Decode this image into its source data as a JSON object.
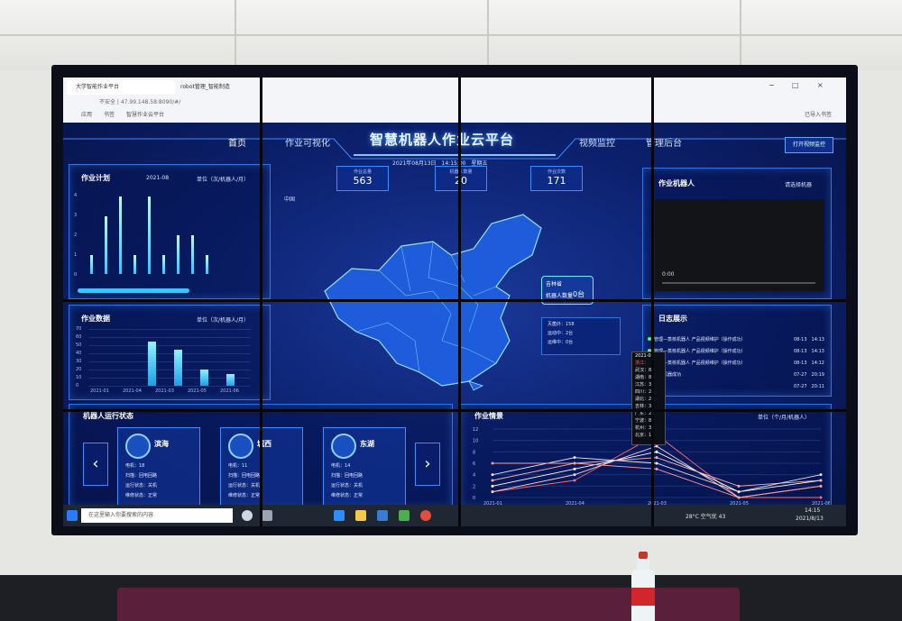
{
  "browser": {
    "tab1": "大学智能作业平台",
    "tab2": "robot管理_智能制造",
    "address": "不安全 | 47.99.148.58:8090/#/",
    "bookmarks": [
      "应用",
      "书签",
      "智慧作业云平台"
    ],
    "right_link": "已导入书签"
  },
  "header": {
    "nav": [
      "首页",
      "作业可视化",
      "视频监控",
      "管理后台"
    ],
    "title": "智慧机器人作业云平台",
    "datetime": "2021年08月13日　14:15:00　星期五",
    "button": "打开视频监控"
  },
  "stats": [
    {
      "label": "作业总量",
      "value": "563"
    },
    {
      "label": "机器人数量",
      "value": "20"
    },
    {
      "label": "作业次数",
      "value": "171"
    }
  ],
  "plan_panel": {
    "title": "作业计划",
    "month": "2021-08",
    "unit": "单位（次/机器人/月）",
    "yticks": [
      "4",
      "3",
      "2",
      "1",
      "0"
    ],
    "chart_data": {
      "type": "bar",
      "values": [
        1,
        3,
        4,
        1,
        4,
        1,
        2,
        2,
        1,
        0,
        0,
        0
      ]
    }
  },
  "data_panel": {
    "title": "作业数据",
    "unit": "单位（次/机器人/月）",
    "yticks": [
      "70",
      "60",
      "50",
      "40",
      "30",
      "20",
      "10",
      "0"
    ],
    "xticks": [
      "2021-01",
      "2021-04",
      "2021-03",
      "2021-05",
      "2021-06"
    ],
    "chart_data": {
      "type": "bar",
      "values": [
        0,
        0,
        55,
        45,
        20,
        15
      ]
    }
  },
  "map": {
    "label": "中国",
    "tooltip_name": "吉林省",
    "tooltip_sub": "机器人数量",
    "tooltip_value": "0台",
    "info": [
      "灭菌外：158",
      "运动中：2台",
      "运维中：0台"
    ]
  },
  "robot_panel": {
    "title": "作业机器人",
    "select": "请选择机器"
  },
  "video": {
    "time": "0:00"
  },
  "log_panel": {
    "title": "日志展示",
    "rows": [
      {
        "text": "管理—蒸核机器人 产品视频维护（操作成功）",
        "time": "08-13　14:13"
      },
      {
        "text": "管理—蒸核机器人 产品视频维护（操作成功）",
        "time": "08-13　14:13"
      },
      {
        "text": "管理—蒸核机器人 产品视频维护（操作成功）",
        "time": "08-13　14:12"
      },
      {
        "text": "新增机器成功",
        "time": "07-27　20:19"
      },
      {
        "text": "外部",
        "time": "07-27　20:11"
      }
    ]
  },
  "dropdown": {
    "header": "2021-06",
    "items": [
      "浙江：",
      "武汉：8",
      "湖南：8",
      "江苏：3",
      "四川：2",
      "湖北：2",
      "吉林：3",
      "广东：2",
      "宁波：8",
      "杭州：3",
      "北京：12"
    ]
  },
  "status_panel": {
    "title": "机器人运行状态",
    "cards": [
      {
        "name": "滨海",
        "lines": [
          "电机：18",
          "扫描：回电回路",
          "运行状态：关机",
          "维修状态：正常"
        ]
      },
      {
        "name": "城西",
        "lines": [
          "电机：11",
          "扫描：回电回路",
          "运行状态：关机",
          "维修状态：正常"
        ]
      },
      {
        "name": "东湖",
        "lines": [
          "电机：14",
          "扫描：回电回路",
          "运行状态：关机",
          "维修状态：正常"
        ]
      }
    ]
  },
  "work_panel": {
    "title": "作业情景",
    "unit": "单位（个/月/机器人）",
    "yticks": [
      "12",
      "10",
      "8",
      "6",
      "4",
      "2",
      "0"
    ],
    "xticks": [
      "2021-01",
      "2021-04",
      "2021-03",
      "2021-05",
      "2021-06"
    ],
    "chart_data": {
      "type": "line",
      "ylim": [
        0,
        12
      ],
      "x": [
        "2021-01",
        "2021-04",
        "2021-03",
        "2021-05",
        "2021-06"
      ],
      "series": [
        {
          "values": [
            1,
            3,
            11,
            0,
            0
          ]
        },
        {
          "values": [
            1,
            4,
            9,
            0,
            2
          ]
        },
        {
          "values": [
            2,
            5,
            8,
            1,
            3
          ]
        },
        {
          "values": [
            3,
            6,
            7,
            2,
            3
          ]
        },
        {
          "values": [
            4,
            7,
            6,
            1,
            4
          ]
        },
        {
          "values": [
            6,
            6,
            5,
            0,
            2
          ]
        }
      ]
    }
  },
  "taskbar": {
    "search": "在这里输入你要搜索的内容",
    "weather": "28°C 空气优 43",
    "time": "14:15",
    "date": "2021/8/13"
  }
}
